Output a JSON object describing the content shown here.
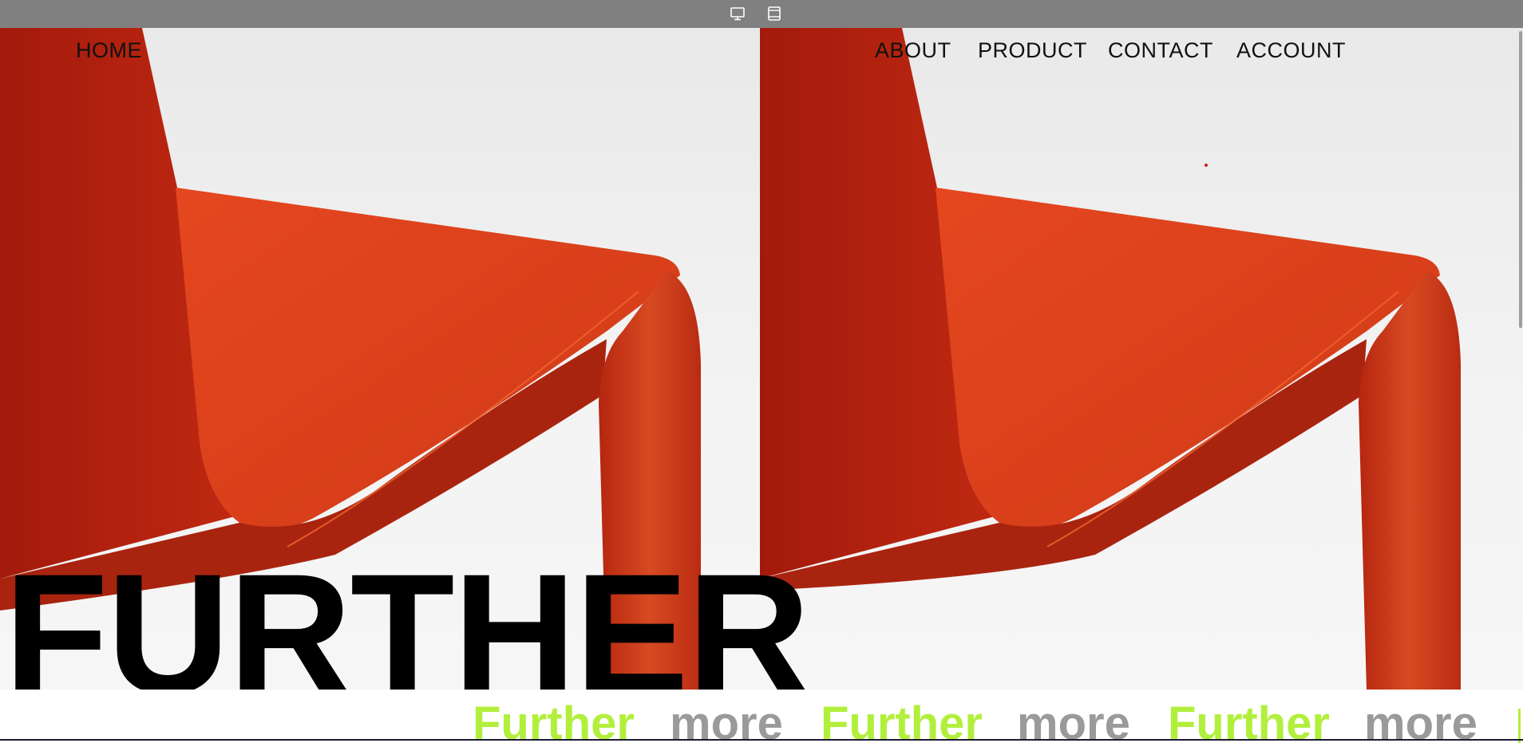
{
  "toolbar": {
    "desktop_icon": "desktop-monitor-icon",
    "tablet_icon": "tablet-layout-icon"
  },
  "nav": {
    "home": "HOME",
    "about": "ABOUT",
    "product": "PRODUCT",
    "contact": "CONTACT",
    "account": "ACCOUNT"
  },
  "hero": {
    "title": "FURTHER",
    "image": "orange-chair-photo"
  },
  "marquee": {
    "words": [
      "Further",
      "more",
      "Further",
      "more",
      "Further",
      "more"
    ]
  },
  "colors": {
    "toolbar": "#808080",
    "chair_orange": "#e24a22",
    "chair_dark": "#b3200e",
    "accent_green": "#b2ef3d",
    "muted_gray": "#9a9a9a",
    "text": "#111111"
  }
}
